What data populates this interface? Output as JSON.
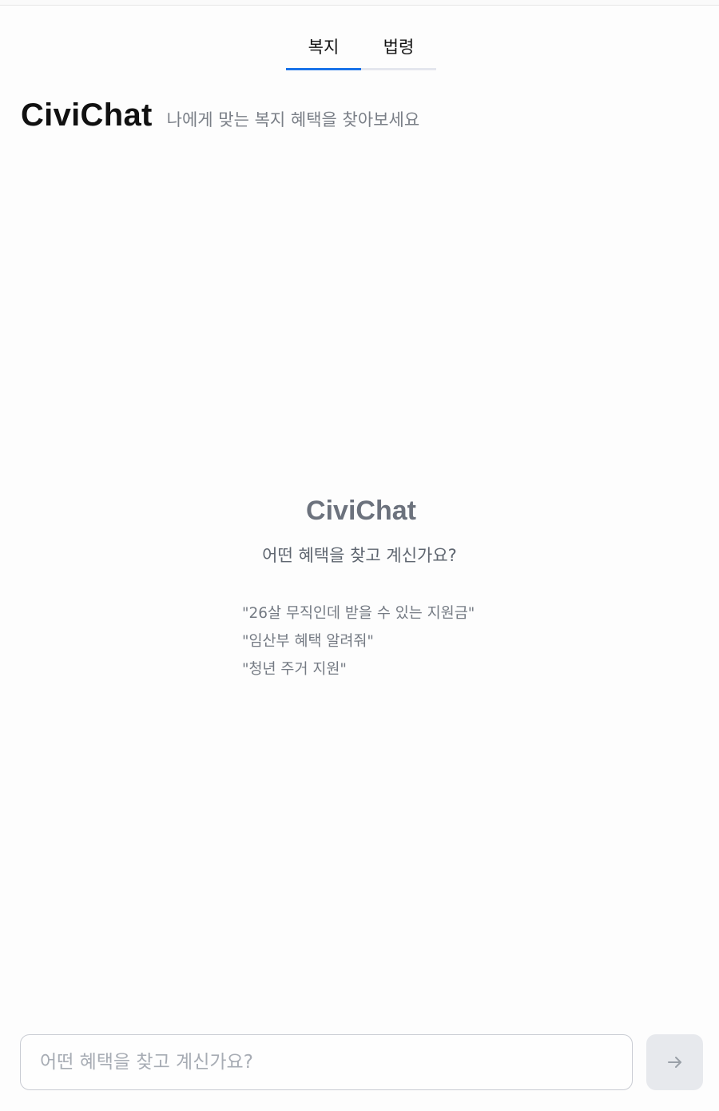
{
  "tabs": [
    {
      "label": "복지",
      "active": true
    },
    {
      "label": "법령",
      "active": false
    }
  ],
  "header": {
    "brand": "CiviChat",
    "tagline": "나에게 맞는 복지 혜택을 찾아보세요"
  },
  "empty_state": {
    "brand": "CiviChat",
    "question": "어떤 혜택을 찾고 계신가요?",
    "examples": [
      "\"26살 무직인데 받을 수 있는 지원금\"",
      "\"임산부 혜택 알려줘\"",
      "\"청년 주거 지원\""
    ]
  },
  "composer": {
    "value": "",
    "placeholder": "어떤 혜택을 찾고 계신가요?",
    "send_icon": "arrow-right-icon"
  },
  "colors": {
    "accent": "#1a73e8",
    "send_button_bg": "#e7e9ed",
    "muted_text": "#7a7f87"
  }
}
